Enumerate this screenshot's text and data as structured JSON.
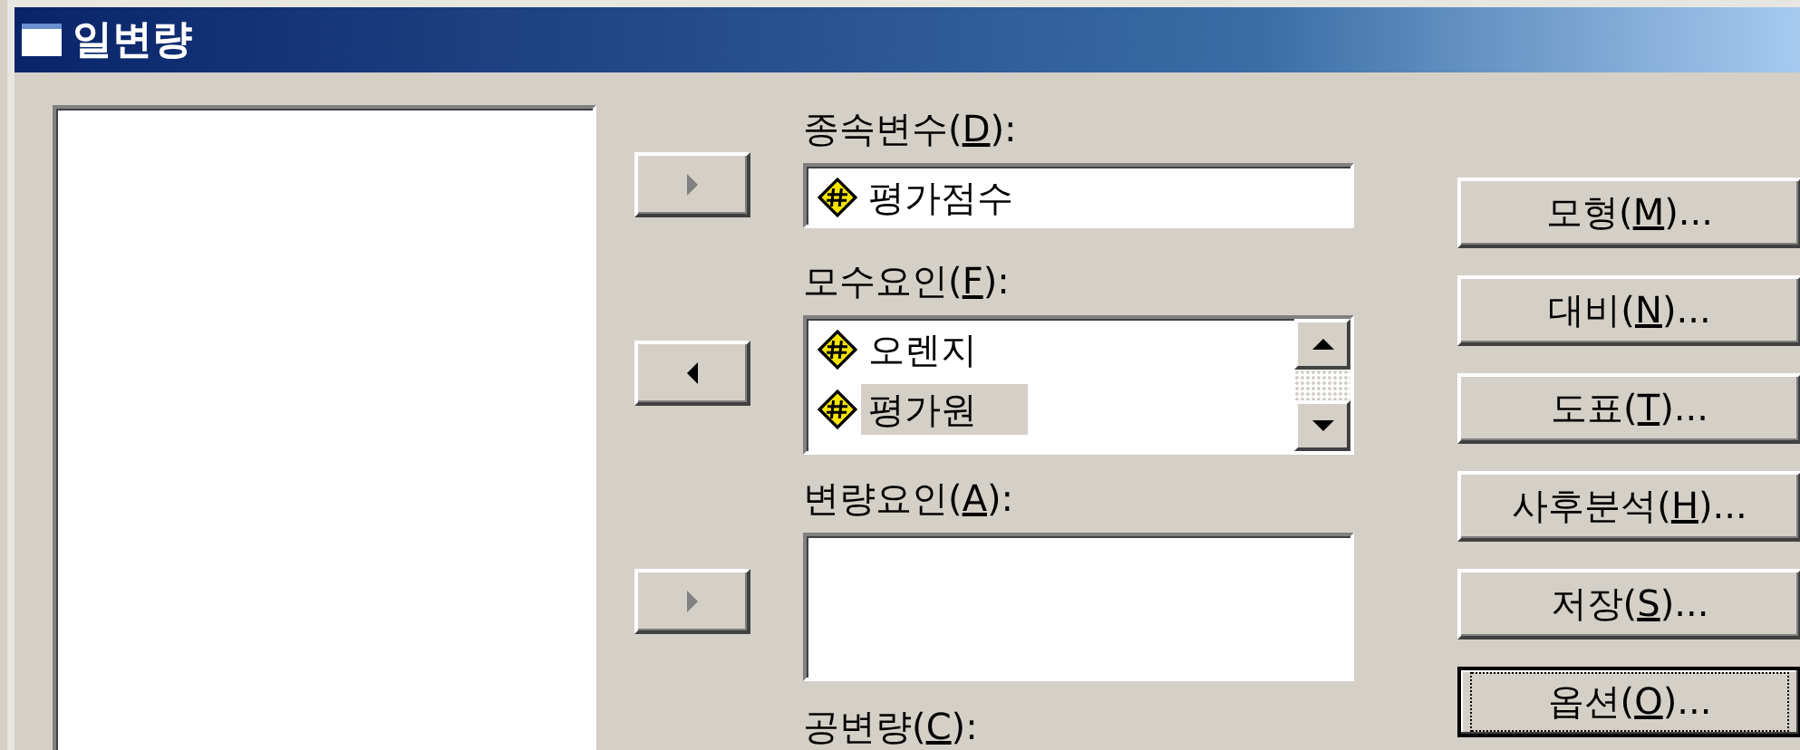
{
  "window": {
    "title": "일변량"
  },
  "move_buttons": [
    {
      "kind": "right",
      "disabled": true
    },
    {
      "kind": "left",
      "disabled": false
    },
    {
      "kind": "right",
      "disabled": true
    }
  ],
  "fields": [
    {
      "kind": "single",
      "label": {
        "before": "종속변수(",
        "key": "D",
        "after": "):"
      },
      "items": [
        {
          "text": "평가점수",
          "selected": false
        }
      ]
    },
    {
      "kind": "scroll",
      "label": {
        "before": "모수요인(",
        "key": "F",
        "after": "):"
      },
      "items": [
        {
          "text": "오렌지",
          "selected": false
        },
        {
          "text": "평가원",
          "selected": true
        }
      ]
    },
    {
      "kind": "box",
      "label": {
        "before": "변량요인(",
        "key": "A",
        "after": "):"
      }
    },
    {
      "kind": "label",
      "label": {
        "before": "공변량(",
        "key": "C",
        "after": "):"
      }
    }
  ],
  "buttons": [
    {
      "label": {
        "before": "모형(",
        "key": "M",
        "after": ")..."
      },
      "focused": false
    },
    {
      "label": {
        "before": "대비(",
        "key": "N",
        "after": ")..."
      },
      "focused": false
    },
    {
      "label": {
        "before": "도표(",
        "key": "T",
        "after": ")..."
      },
      "focused": false
    },
    {
      "label": {
        "before": "사후분석(",
        "key": "H",
        "after": ")..."
      },
      "focused": false
    },
    {
      "label": {
        "before": "저장(",
        "key": "S",
        "after": ")..."
      },
      "focused": false
    },
    {
      "label": {
        "before": "옵션(",
        "key": "O",
        "after": ")..."
      },
      "focused": true
    }
  ]
}
